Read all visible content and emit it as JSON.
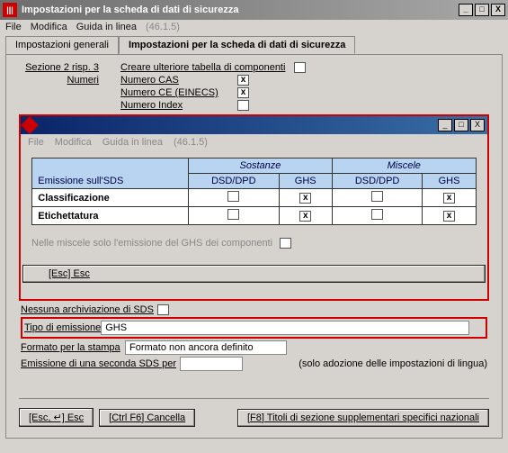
{
  "window": {
    "icon_glyph": "|||",
    "title": "Impostazioni per la scheda di dati di sicurezza",
    "controls": {
      "min": "_",
      "max": "□",
      "close": "X"
    }
  },
  "menubar": {
    "file": "File",
    "edit": "Modifica",
    "help": "Guida in linea",
    "version": "(46.1.5)"
  },
  "tabs": {
    "general": "Impostazioni generali",
    "sds": "Impostazioni per la scheda di dati di sicurezza"
  },
  "top": {
    "section": "Sezione 2 risp. 3",
    "create_table": "Creare ulteriore tabella di componenti",
    "numbers": "Numeri",
    "cas": "Numero CAS",
    "einecs": "Numero CE (EINECS)",
    "index": "Numero Index"
  },
  "inner": {
    "menubar": {
      "file": "File",
      "edit": "Modifica",
      "help": "Guida in linea",
      "version": "(46.1.5)"
    },
    "table": {
      "rowheader": "Emissione sull'SDS",
      "groups": {
        "sostanze": "Sostanze",
        "miscele": "Miscele"
      },
      "subs": {
        "dsd": "DSD/DPD",
        "ghs": "GHS"
      },
      "rows": {
        "classif": "Classificazione",
        "etich": "Etichettatura"
      }
    },
    "note": "Nelle miscele solo l'emissione del GHS dei componenti",
    "esc_btn": "[Esc] Esc"
  },
  "bottom": {
    "no_archive": "Nessuna archiviazione di SDS",
    "tipo_label": "Tipo di emissione",
    "tipo_value": "GHS",
    "formato_label": "Formato per la stampa",
    "formato_value": "Formato non ancora definito",
    "second_sds": "Emissione di una seconda SDS per",
    "lang_note": "(solo adozione delle impostazioni di lingua)"
  },
  "buttons": {
    "esc": "[Esc, ↵] Esc",
    "cancel": "[Ctrl F6] Cancella",
    "f8": "[F8] Titoli di sezione supplementari specifici nazionali"
  }
}
